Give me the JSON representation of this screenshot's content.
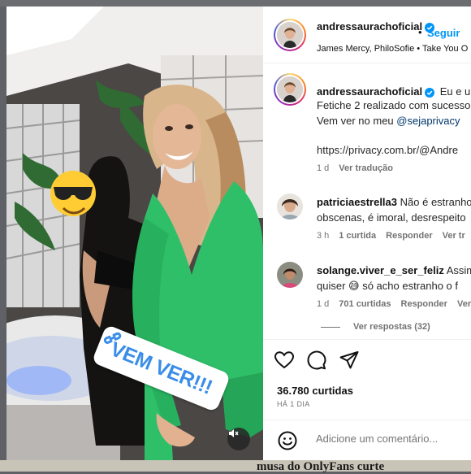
{
  "background": {
    "headline_fragment": "musa do OnlyFans curte"
  },
  "post": {
    "sticker_label": "VEM VER!!!",
    "sticker_emoji": "😎",
    "mute_icon": "speaker-muted-icon"
  },
  "header": {
    "username": "andressaurachoficial",
    "follow_label": "Seguir",
    "separator": "•",
    "audio_text": "James Mercy, PhiloSofie • Take You O"
  },
  "caption": {
    "username": "andressaurachoficial",
    "line1": "Eu e um",
    "line2": "Fetiche 2 realizado com sucesso",
    "line3_prefix": "Vem ver no meu ",
    "line3_mention": "@sejaprivacy",
    "line4": "https://privacy.com.br/@Andre",
    "age": "1 d",
    "see_translation": "Ver tradução"
  },
  "comments": [
    {
      "username": "patriciaestrella3",
      "line1": "Não é estranho",
      "line2": "obscenas, é imoral, desrespeito",
      "age": "3 h",
      "likes": "1 curtida",
      "reply": "Responder",
      "translate": "Ver tr"
    },
    {
      "username": "solange.viver_e_ser_feliz",
      "line1": "Assim",
      "line2_prefix": "quiser ",
      "line2_emoji": "😅",
      "line2_suffix": " só acho estranho o f",
      "age": "1 d",
      "likes": "701 curtidas",
      "reply": "Responder",
      "translate": "Ver"
    }
  ],
  "replies_label": "Ver respostas (32)",
  "actions": {
    "like_icon": "heart-icon",
    "comment_icon": "comment-bubble-icon",
    "share_icon": "paper-plane-icon"
  },
  "likes_count": "36.780 curtidas",
  "time_ago": "HÁ 1 DIA",
  "comment_box": {
    "placeholder": "Adicione um comentário...",
    "emoji_icon": "smiley-icon"
  },
  "colors": {
    "link_blue": "#0095f6",
    "verified_blue": "#0095f6",
    "mention_blue": "#00376b",
    "muted_text": "#737373",
    "dress_green": "#2fbf69"
  }
}
